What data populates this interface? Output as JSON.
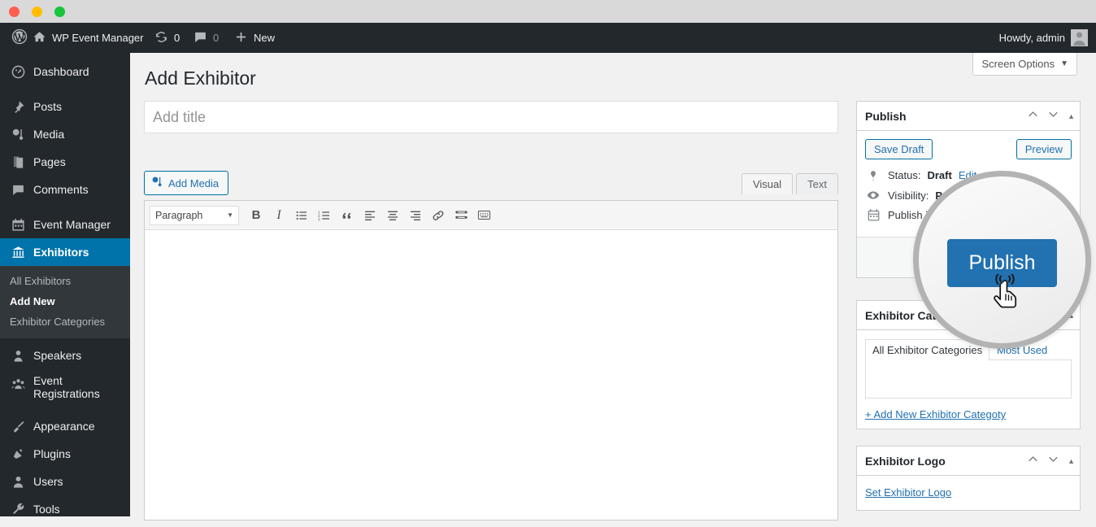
{
  "window": {
    "traffic_lights": [
      "close",
      "minimize",
      "maximize"
    ],
    "colors": {
      "close": "#ff5f52",
      "minimize": "#ffbd00",
      "maximize": "#15c53a"
    }
  },
  "adminbar": {
    "wp_logo": "wordpress-logo-icon",
    "site_name": "WP Event Manager",
    "site_icon": "home-icon",
    "updates_icon": "updates-icon",
    "updates_count": "0",
    "comments_icon": "comment-bubble-icon",
    "comments_count": "0",
    "new_icon": "plus-icon",
    "new_label": "New",
    "howdy": "Howdy, admin",
    "avatar": "user-avatar"
  },
  "sidebar": {
    "items": [
      {
        "label": "Dashboard",
        "icon": "dashboard-icon",
        "current": false
      },
      {
        "label": "Posts",
        "icon": "pin-icon",
        "current": false,
        "gap": true
      },
      {
        "label": "Media",
        "icon": "media-icon",
        "current": false
      },
      {
        "label": "Pages",
        "icon": "pages-icon",
        "current": false
      },
      {
        "label": "Comments",
        "icon": "comments-icon",
        "current": false
      },
      {
        "label": "Event Manager",
        "icon": "calendar-icon",
        "current": false,
        "gap": true
      },
      {
        "label": "Exhibitors",
        "icon": "bank-icon",
        "current": true
      }
    ],
    "submenu": [
      {
        "label": "All Exhibitors",
        "current": false
      },
      {
        "label": "Add New",
        "current": true
      },
      {
        "label": "Exhibitor Categories",
        "current": false
      }
    ],
    "items_after": [
      {
        "label": "Speakers",
        "icon": "speaker-person-icon",
        "current": false
      },
      {
        "label": "Event Registrations",
        "icon": "group-icon",
        "current": false,
        "two_line": true
      },
      {
        "label": "Appearance",
        "icon": "brush-icon",
        "current": false,
        "gap": true
      },
      {
        "label": "Plugins",
        "icon": "plug-icon",
        "current": false
      },
      {
        "label": "Users",
        "icon": "user-icon",
        "current": false
      },
      {
        "label": "Tools",
        "icon": "wrench-icon",
        "current": false
      }
    ]
  },
  "main": {
    "screen_options_label": "Screen Options",
    "screen_options_caret": "chevron-down-icon",
    "page_title": "Add Exhibitor",
    "title_placeholder": "Add title",
    "add_media_label": "Add Media",
    "add_media_icon": "media-icon",
    "editor_tabs": [
      {
        "label": "Visual",
        "active": true
      },
      {
        "label": "Text",
        "active": false
      }
    ],
    "toolbar": {
      "format_select": "Paragraph",
      "buttons": [
        {
          "name": "bold-icon",
          "glyph": "B"
        },
        {
          "name": "italic-icon",
          "glyph": "I"
        },
        {
          "name": "bulleted-list-icon",
          "glyph": ""
        },
        {
          "name": "numbered-list-icon",
          "glyph": ""
        },
        {
          "name": "blockquote-icon",
          "glyph": "“"
        },
        {
          "name": "align-left-icon",
          "glyph": ""
        },
        {
          "name": "align-center-icon",
          "glyph": ""
        },
        {
          "name": "align-right-icon",
          "glyph": ""
        },
        {
          "name": "insert-link-icon",
          "glyph": ""
        },
        {
          "name": "read-more-icon",
          "glyph": ""
        },
        {
          "name": "toolbar-toggle-icon",
          "glyph": ""
        }
      ]
    },
    "editor_content": ""
  },
  "publish_box": {
    "title": "Publish",
    "save_draft_label": "Save Draft",
    "preview_label": "Preview",
    "status_icon": "pin-marker-icon",
    "status_label": "Status:",
    "status_value": "Draft",
    "status_edit": "Edit",
    "visibility_icon": "eye-icon",
    "visibility_label": "Visibility:",
    "visibility_value": "Pu",
    "publish_icon": "calendar-icon",
    "publish_label": "Publish i"
  },
  "categories_box": {
    "title": "Exhibitor Catego",
    "tabs": [
      {
        "label": "All Exhibitor Categories",
        "active": true
      },
      {
        "label": "Most Used",
        "active": false
      }
    ],
    "list_items": [],
    "add_new_link": "+ Add New Exhibitor Categoty"
  },
  "logo_box": {
    "title": "Exhibitor Logo",
    "set_logo_link": "Set Exhibitor Logo"
  },
  "magnifier": {
    "publish_button_label": "Publish",
    "publish_button_color": "#2271b1",
    "cursor_icon": "click-hand-cursor"
  }
}
